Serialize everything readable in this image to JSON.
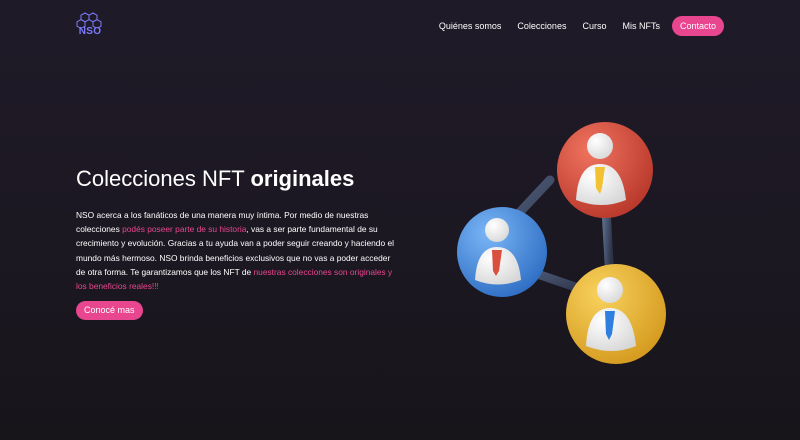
{
  "brand": {
    "name": "NSO",
    "icon": "hexagon-cluster-logo-icon"
  },
  "nav": {
    "items": [
      "Quiénes somos",
      "Colecciones",
      "Curso",
      "Mis NFTs"
    ],
    "contact_label": "Contacto"
  },
  "hero": {
    "title_regular": "Colecciones NFT ",
    "title_bold": "originales",
    "text": {
      "part1": "NSO acerca a los fanáticos de una manera muy íntima. Por medio de nuestras colecciones ",
      "link1": "podés poseer parte de su historia",
      "part2": ", vas a ser parte fundamental de su crecimiento y evolución. Gracias a tu ayuda van a poder seguir creando y haciendo el mundo más hermoso. NSO brinda beneficios exclusivos que no vas a poder acceder de otra forma. Te garantizamos que los NFT de ",
      "link2": "nuestras colecciones son originales y los beneficios reales!!!"
    },
    "cta_label": "Conocé mas"
  },
  "illustration": {
    "name": "user-network-illustration",
    "nodes": [
      {
        "name": "red-user-node",
        "color": "#d9503f",
        "tie_color": "#f2c232"
      },
      {
        "name": "blue-user-node",
        "color": "#4a90e6",
        "tie_color": "#d9503f"
      },
      {
        "name": "yellow-user-node",
        "color": "#efb93a",
        "tie_color": "#2f7fe0"
      }
    ]
  },
  "colors": {
    "accent": "#e8468f",
    "logo": "#7d7cff",
    "background": "#1d1924"
  }
}
